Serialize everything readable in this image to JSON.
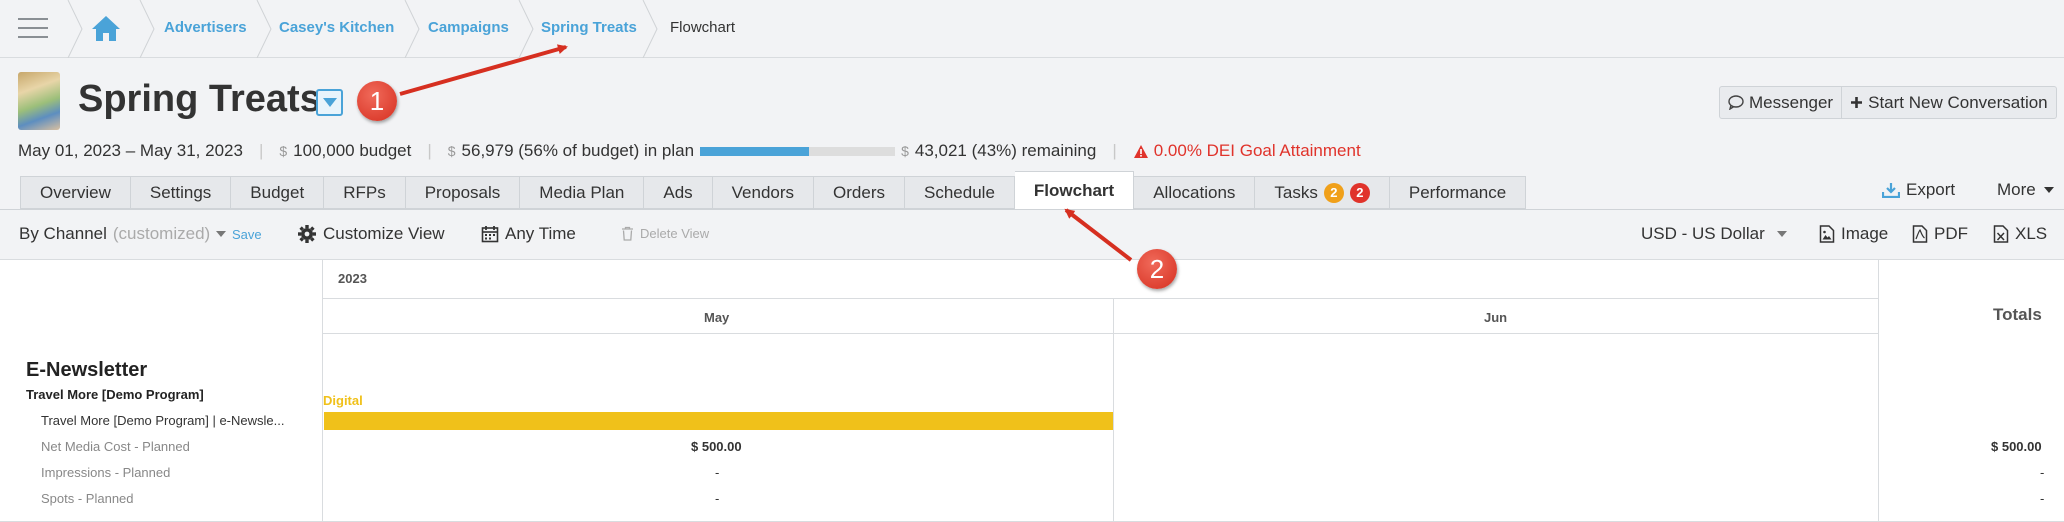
{
  "breadcrumbs": {
    "items": [
      "Advertisers",
      "Casey's Kitchen",
      "Campaigns",
      "Spring Treats"
    ],
    "current": "Flowchart"
  },
  "campaign": {
    "title": "Spring Treats",
    "dates": "May 01, 2023 – May 31, 2023",
    "budget": "100,000 budget",
    "in_plan": "56,979 (56% of budget) in plan",
    "plan_percent": 56,
    "remaining": "43,021 (43%) remaining",
    "dei": "0.00% DEI Goal Attainment",
    "currency_symbol": "$"
  },
  "messenger": {
    "messenger_label": "Messenger",
    "new_conv_label": "Start New Conversation"
  },
  "tabs": [
    {
      "label": "Overview"
    },
    {
      "label": "Settings"
    },
    {
      "label": "Budget"
    },
    {
      "label": "RFPs"
    },
    {
      "label": "Proposals"
    },
    {
      "label": "Media Plan"
    },
    {
      "label": "Ads"
    },
    {
      "label": "Vendors"
    },
    {
      "label": "Orders"
    },
    {
      "label": "Schedule"
    },
    {
      "label": "Flowchart",
      "active": true
    },
    {
      "label": "Allocations"
    },
    {
      "label": "Tasks",
      "badges": [
        "2",
        "2"
      ]
    },
    {
      "label": "Performance"
    }
  ],
  "header_actions": {
    "export": "Export",
    "more": "More"
  },
  "toolbar": {
    "view": "By Channel",
    "customized": "(customized)",
    "save": "Save",
    "customize_view": "Customize View",
    "time": "Any Time",
    "delete_view": "Delete View",
    "currency": "USD - US Dollar",
    "image": "Image",
    "pdf": "PDF",
    "xls": "XLS"
  },
  "flowchart": {
    "year": "2023",
    "months": [
      "May",
      "Jun"
    ],
    "totals_label": "Totals",
    "channel": "E-Newsletter",
    "program": "Travel More [Demo Program]",
    "placement": "Travel More [Demo Program] | e-Newsle...",
    "bar_label": "Digital",
    "metrics": [
      {
        "label": "Net Media Cost - Planned",
        "may": "$ 500.00",
        "total": "$ 500.00"
      },
      {
        "label": "Impressions - Planned",
        "may": "-",
        "total": "-"
      },
      {
        "label": "Spots - Planned",
        "may": "-",
        "total": "-"
      }
    ]
  },
  "callouts": [
    "1",
    "2"
  ],
  "colors": {
    "accent": "#4aa3d8",
    "bar": "#f0c11a",
    "badge_orange": "#f0a01a",
    "badge_red": "#e0332b",
    "callout": "#d62f20"
  }
}
